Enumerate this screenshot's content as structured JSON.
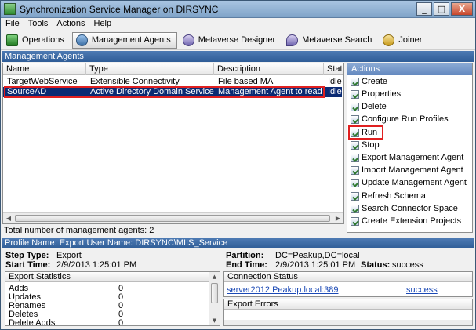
{
  "window": {
    "title": "Synchronization Service Manager on DIRSYNC",
    "minimize": "_",
    "maximize": "□",
    "close": "X"
  },
  "menu": [
    "File",
    "Tools",
    "Actions",
    "Help"
  ],
  "toolbar": [
    {
      "label": "Operations",
      "icon": "operations-icon"
    },
    {
      "label": "Management Agents",
      "icon": "management-agents-icon",
      "active": true
    },
    {
      "label": "Metaverse Designer",
      "icon": "metaverse-designer-icon"
    },
    {
      "label": "Metaverse Search",
      "icon": "metaverse-search-icon"
    },
    {
      "label": "Joiner",
      "icon": "joiner-icon"
    }
  ],
  "management_agents": {
    "header": "Management Agents",
    "columns": [
      "Name",
      "Type",
      "Description",
      "State"
    ],
    "rows": [
      {
        "name": "TargetWebService",
        "type": "Extensible Connectivity",
        "description": "File based MA",
        "state": "Idle",
        "selected": false
      },
      {
        "name": "SourceAD",
        "type": "Active Directory Domain Services",
        "description": "Management Agent to read fro...",
        "state": "Idle",
        "selected": true
      }
    ],
    "total": "Total number of management agents: 2"
  },
  "actions": {
    "header": "Actions",
    "items": [
      "Create",
      "Properties",
      "Delete",
      "Configure Run Profiles",
      "Run",
      "Stop",
      "Export Management Agent",
      "Import Management Agent",
      "Update Management Agent",
      "Refresh Schema",
      "Search Connector Space",
      "Create Extension Projects"
    ]
  },
  "profile": {
    "header": "Profile Name: Export  User Name: DIRSYNC\\MIIS_Service",
    "step_type_label": "Step Type:",
    "step_type": "Export",
    "start_time_label": "Start Time:",
    "start_time": "2/9/2013 1:25:01 PM",
    "partition_label": "Partition:",
    "partition": "DC=Peakup,DC=local",
    "end_time_label": "End Time:",
    "end_time": "2/9/2013 1:25:01 PM",
    "status_label": "Status:",
    "status": "success"
  },
  "export_statistics": {
    "header": "Export Statistics",
    "rows": [
      {
        "label": "Adds",
        "value": "0"
      },
      {
        "label": "Updates",
        "value": "0"
      },
      {
        "label": "Renames",
        "value": "0"
      },
      {
        "label": "Deletes",
        "value": "0"
      },
      {
        "label": "Delete Adds",
        "value": "0"
      }
    ]
  },
  "connection_status": {
    "header": "Connection Status",
    "server": "server2012.Peakup.local:389",
    "result": "success"
  },
  "export_errors": {
    "header": "Export Errors"
  },
  "colors": {
    "selection": "#0a2a73",
    "highlight_outline": "#e02020",
    "header_blue": "#2f5d97",
    "link": "#1b49b5"
  }
}
